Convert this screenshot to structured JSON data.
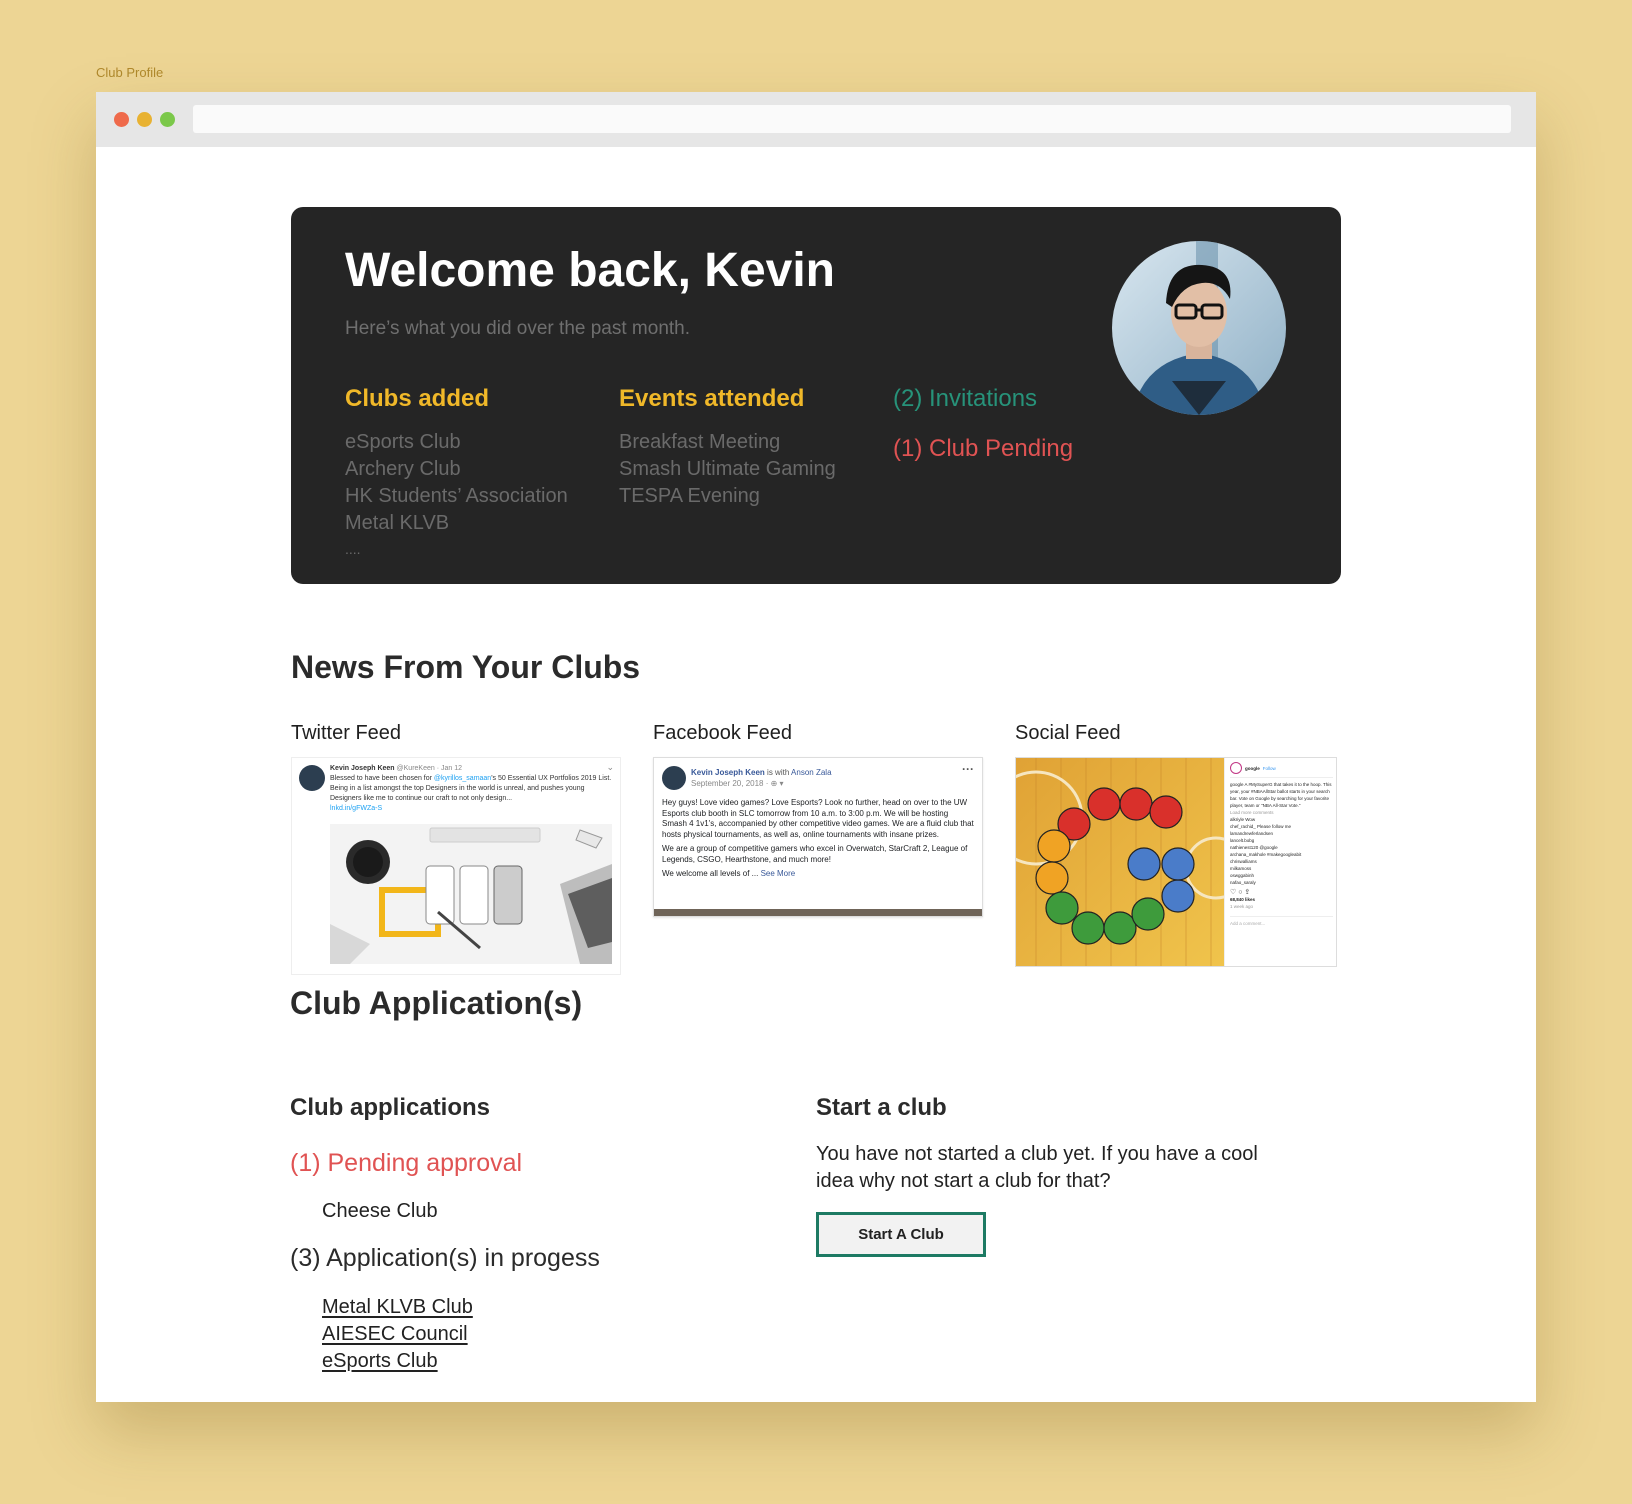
{
  "page_label": "Club Profile",
  "hero": {
    "title": "Welcome back, Kevin",
    "subtitle": "Here’s what you did over the past month.",
    "clubs_added": {
      "heading": "Clubs added",
      "items": [
        "eSports Club",
        "Archery Club",
        "HK Students’ Association",
        "Metal KLVB",
        "...."
      ]
    },
    "events_attended": {
      "heading": "Events attended",
      "items": [
        "Breakfast Meeting",
        "Smash Ultimate Gaming",
        "TESPA Evening"
      ]
    },
    "invitations": "(2) Invitations",
    "club_pending": "(1) Club Pending"
  },
  "news": {
    "title": "News From Your Clubs",
    "twitter": {
      "label": "Twitter Feed",
      "name": "Kevin Joseph Keen",
      "handle": "@KureKeen · Jan 12",
      "text_before": "Blessed to have been chosen for ",
      "mention": "@kyrillos_samaan",
      "text_after": "'s 50 Essential UX Portfolios 2019 List. Being in a list amongst the top Designers in the world is unreal, and pushes young Designers like me to continue our craft to not only design...",
      "link": "lnkd.in/gFWZa-S"
    },
    "facebook": {
      "label": "Facebook Feed",
      "name": "Kevin Joseph Keen",
      "with_text": " is with ",
      "with_name": "Anson Zala",
      "date": "September 20, 2018 · ",
      "para1": "Hey guys! Love video games? Love Esports? Look no further, head on over to the UW Esports club booth in SLC tomorrow from 10 a.m. to 3:00 p.m. We will be hosting Smash 4 1v1's, accompanied by other competitive video games. We are a fluid club that hosts physical tournaments, as well as, online tournaments with insane prizes.",
      "para2": "We are a group of competitive gamers who excel in Overwatch, StarCraft 2, League of Legends, CSGO, Hearthstone, and much more!",
      "para3": "We welcome all levels of ... ",
      "see_more": "See More"
    },
    "social": {
      "label": "Social Feed",
      "account": "google",
      "follow": "Follow",
      "caption": "google A #MySuperG that takes it to the hoop. This year, your #NBAAllStar ballot starts in your search bar. Vote on Google by searching for your favorite player, team or \"NBA All-Star Vote.\"",
      "load_more": "Load more comments",
      "comments": [
        "alkriyle Wow",
        "chef_rachid_ Please follow me",
        "lamandrewferlandsen",
        "lancelt.bobg",
        "nathienest120 @google",
        "archana_makhole #makegoogleabit",
        "chriswalliams",
        "milkamoss",
        "oswggabinh",
        "nafao_saraly"
      ],
      "likes": "68,840 likes",
      "time": "1 week ago",
      "add_comment": "Add a comment..."
    }
  },
  "applications": {
    "title": "Club Application(s)",
    "sub_title": "Club applications",
    "pending_label": "(1) Pending approval",
    "pending_items": [
      "Cheese Club"
    ],
    "progress_label": "(3) Application(s) in progess",
    "progress_items": [
      "Metal KLVB Club",
      "AIESEC Council",
      "eSports Club"
    ]
  },
  "start_club": {
    "title": "Start a club",
    "text": "You have not started a club yet. If you have a cool idea why not start a club for that?",
    "button": "Start A Club"
  },
  "colors": {
    "background": "#edd594",
    "hero_bg": "#252525",
    "accent_yellow": "#f0b829",
    "accent_green": "#27937a",
    "accent_red": "#e05353",
    "button_border": "#1d7a63"
  }
}
